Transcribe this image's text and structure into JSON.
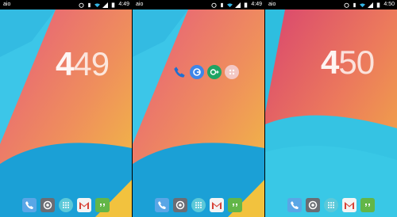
{
  "screens": [
    {
      "status": {
        "app_label": "aio",
        "time": "4:49"
      },
      "clock": {
        "hour": "4",
        "minute": "49"
      }
    },
    {
      "status": {
        "app_label": "aio",
        "time": "4:49"
      }
    },
    {
      "status": {
        "app_label": "aio",
        "time": "4:50"
      },
      "clock": {
        "hour": "4",
        "minute": "50"
      }
    }
  ],
  "dock_icons": [
    "phone-icon",
    "camera-icon",
    "app-drawer-icon",
    "gmail-icon",
    "hangouts-icon"
  ],
  "folder_icons": [
    "phone-icon",
    "google-search-icon",
    "google-plus-icon",
    "app-drawer-icon"
  ],
  "colors": {
    "wall_pink": "#e2577a",
    "wall_orange": "#f0a24c",
    "wall_yellow": "#f2c23e",
    "wall_cyan": "#38c8e6",
    "wall_blue": "#1aa7d8",
    "phone_blue": "#5aa6e6",
    "camera_gray": "#6a6d74",
    "drawer_teal": "#5cc9d9",
    "gmail_red": "#d74136",
    "hangouts_green": "#63b648"
  }
}
